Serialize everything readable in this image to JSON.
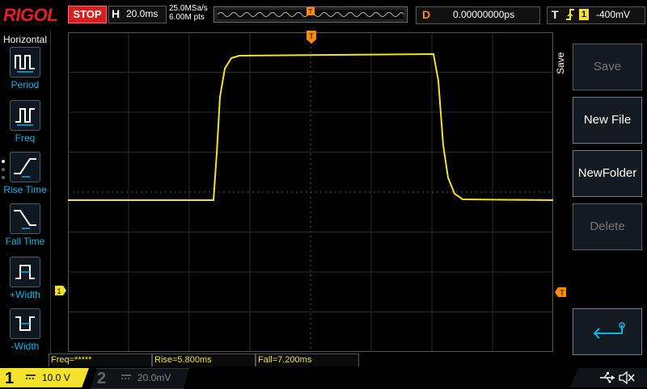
{
  "brand": "RIGOL",
  "top": {
    "run_state": "STOP",
    "timebase_label": "H",
    "timebase_value": "20.0ms",
    "sample_rate": "25.0MSa/s",
    "memory_depth": "6.00M pts",
    "delay_label": "D",
    "delay_value": "0.00000000ps",
    "trigger_label": "T",
    "trigger_channel": "1",
    "trigger_level": "-400mV"
  },
  "left_menu": {
    "title": "Horizontal",
    "items": [
      {
        "label": "Period",
        "icon": "period-icon"
      },
      {
        "label": "Freq",
        "icon": "frequency-icon"
      },
      {
        "label": "Rise Time",
        "icon": "rise-time-icon"
      },
      {
        "label": "Fall Time",
        "icon": "fall-time-icon"
      },
      {
        "label": "+Width",
        "icon": "positive-width-icon"
      },
      {
        "label": "-Width",
        "icon": "negative-width-icon"
      }
    ]
  },
  "right_menu": {
    "title": "Save",
    "buttons": [
      {
        "label": "Save",
        "enabled": false
      },
      {
        "label": "New File",
        "enabled": true
      },
      {
        "label": "NewFolder",
        "enabled": true
      },
      {
        "label": "Delete",
        "enabled": false
      }
    ],
    "enter_icon": "enter-return-icon"
  },
  "measurements": {
    "freq": "Freq=*****",
    "rise": "Rise=5.800ms",
    "fall": "Fall=7.200ms"
  },
  "channels": {
    "ch1": {
      "number": "1",
      "scale": "10.0 V",
      "coupling_icon": "dc-coupling-icon"
    },
    "ch2": {
      "number": "2",
      "scale": "20.0mV",
      "coupling_icon": "dc-coupling-icon"
    }
  },
  "markers": {
    "trigger_position": "T",
    "ch1_level": "1",
    "trigger_level": "T"
  },
  "status_icons": [
    "usb-icon",
    "speaker-muted-icon"
  ],
  "colors": {
    "ch1": "#f2e22c",
    "trigger": "#ff8c00",
    "stop": "#d61f1f",
    "menu_accent": "#00b7e8"
  }
}
